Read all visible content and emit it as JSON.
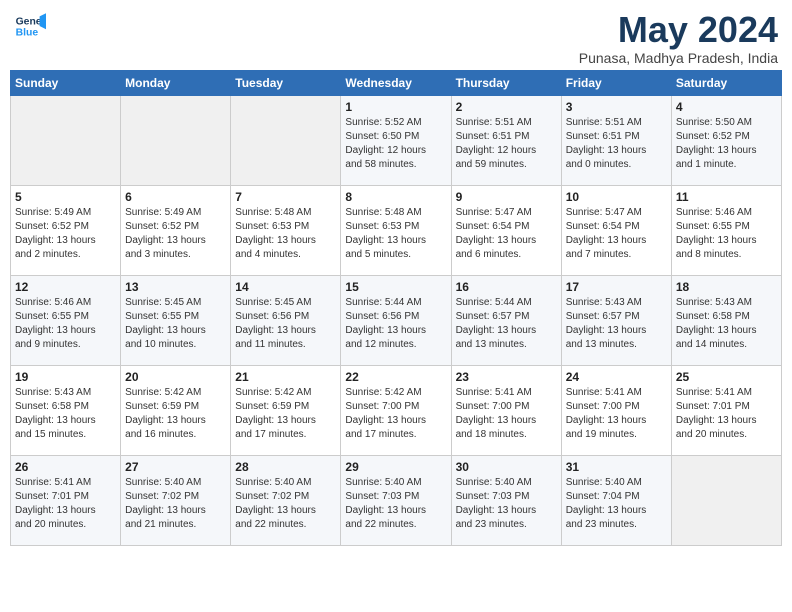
{
  "header": {
    "logo_line1": "General",
    "logo_line2": "Blue",
    "month": "May 2024",
    "location": "Punasa, Madhya Pradesh, India"
  },
  "days_of_week": [
    "Sunday",
    "Monday",
    "Tuesday",
    "Wednesday",
    "Thursday",
    "Friday",
    "Saturday"
  ],
  "weeks": [
    [
      {
        "day": "",
        "content": ""
      },
      {
        "day": "",
        "content": ""
      },
      {
        "day": "",
        "content": ""
      },
      {
        "day": "1",
        "content": "Sunrise: 5:52 AM\nSunset: 6:50 PM\nDaylight: 12 hours\nand 58 minutes."
      },
      {
        "day": "2",
        "content": "Sunrise: 5:51 AM\nSunset: 6:51 PM\nDaylight: 12 hours\nand 59 minutes."
      },
      {
        "day": "3",
        "content": "Sunrise: 5:51 AM\nSunset: 6:51 PM\nDaylight: 13 hours\nand 0 minutes."
      },
      {
        "day": "4",
        "content": "Sunrise: 5:50 AM\nSunset: 6:52 PM\nDaylight: 13 hours\nand 1 minute."
      }
    ],
    [
      {
        "day": "5",
        "content": "Sunrise: 5:49 AM\nSunset: 6:52 PM\nDaylight: 13 hours\nand 2 minutes."
      },
      {
        "day": "6",
        "content": "Sunrise: 5:49 AM\nSunset: 6:52 PM\nDaylight: 13 hours\nand 3 minutes."
      },
      {
        "day": "7",
        "content": "Sunrise: 5:48 AM\nSunset: 6:53 PM\nDaylight: 13 hours\nand 4 minutes."
      },
      {
        "day": "8",
        "content": "Sunrise: 5:48 AM\nSunset: 6:53 PM\nDaylight: 13 hours\nand 5 minutes."
      },
      {
        "day": "9",
        "content": "Sunrise: 5:47 AM\nSunset: 6:54 PM\nDaylight: 13 hours\nand 6 minutes."
      },
      {
        "day": "10",
        "content": "Sunrise: 5:47 AM\nSunset: 6:54 PM\nDaylight: 13 hours\nand 7 minutes."
      },
      {
        "day": "11",
        "content": "Sunrise: 5:46 AM\nSunset: 6:55 PM\nDaylight: 13 hours\nand 8 minutes."
      }
    ],
    [
      {
        "day": "12",
        "content": "Sunrise: 5:46 AM\nSunset: 6:55 PM\nDaylight: 13 hours\nand 9 minutes."
      },
      {
        "day": "13",
        "content": "Sunrise: 5:45 AM\nSunset: 6:55 PM\nDaylight: 13 hours\nand 10 minutes."
      },
      {
        "day": "14",
        "content": "Sunrise: 5:45 AM\nSunset: 6:56 PM\nDaylight: 13 hours\nand 11 minutes."
      },
      {
        "day": "15",
        "content": "Sunrise: 5:44 AM\nSunset: 6:56 PM\nDaylight: 13 hours\nand 12 minutes."
      },
      {
        "day": "16",
        "content": "Sunrise: 5:44 AM\nSunset: 6:57 PM\nDaylight: 13 hours\nand 13 minutes."
      },
      {
        "day": "17",
        "content": "Sunrise: 5:43 AM\nSunset: 6:57 PM\nDaylight: 13 hours\nand 13 minutes."
      },
      {
        "day": "18",
        "content": "Sunrise: 5:43 AM\nSunset: 6:58 PM\nDaylight: 13 hours\nand 14 minutes."
      }
    ],
    [
      {
        "day": "19",
        "content": "Sunrise: 5:43 AM\nSunset: 6:58 PM\nDaylight: 13 hours\nand 15 minutes."
      },
      {
        "day": "20",
        "content": "Sunrise: 5:42 AM\nSunset: 6:59 PM\nDaylight: 13 hours\nand 16 minutes."
      },
      {
        "day": "21",
        "content": "Sunrise: 5:42 AM\nSunset: 6:59 PM\nDaylight: 13 hours\nand 17 minutes."
      },
      {
        "day": "22",
        "content": "Sunrise: 5:42 AM\nSunset: 7:00 PM\nDaylight: 13 hours\nand 17 minutes."
      },
      {
        "day": "23",
        "content": "Sunrise: 5:41 AM\nSunset: 7:00 PM\nDaylight: 13 hours\nand 18 minutes."
      },
      {
        "day": "24",
        "content": "Sunrise: 5:41 AM\nSunset: 7:00 PM\nDaylight: 13 hours\nand 19 minutes."
      },
      {
        "day": "25",
        "content": "Sunrise: 5:41 AM\nSunset: 7:01 PM\nDaylight: 13 hours\nand 20 minutes."
      }
    ],
    [
      {
        "day": "26",
        "content": "Sunrise: 5:41 AM\nSunset: 7:01 PM\nDaylight: 13 hours\nand 20 minutes."
      },
      {
        "day": "27",
        "content": "Sunrise: 5:40 AM\nSunset: 7:02 PM\nDaylight: 13 hours\nand 21 minutes."
      },
      {
        "day": "28",
        "content": "Sunrise: 5:40 AM\nSunset: 7:02 PM\nDaylight: 13 hours\nand 22 minutes."
      },
      {
        "day": "29",
        "content": "Sunrise: 5:40 AM\nSunset: 7:03 PM\nDaylight: 13 hours\nand 22 minutes."
      },
      {
        "day": "30",
        "content": "Sunrise: 5:40 AM\nSunset: 7:03 PM\nDaylight: 13 hours\nand 23 minutes."
      },
      {
        "day": "31",
        "content": "Sunrise: 5:40 AM\nSunset: 7:04 PM\nDaylight: 13 hours\nand 23 minutes."
      },
      {
        "day": "",
        "content": ""
      }
    ]
  ]
}
